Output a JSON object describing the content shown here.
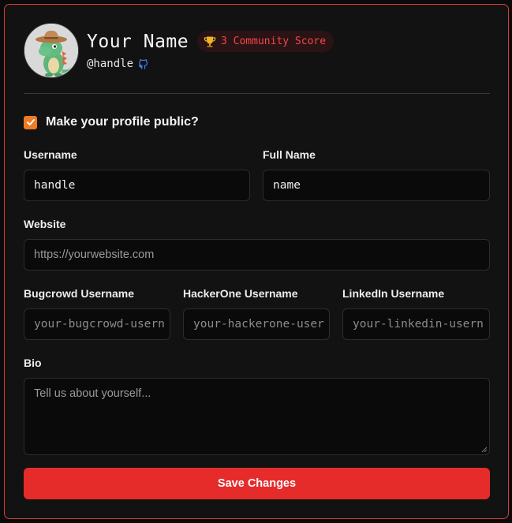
{
  "profile": {
    "display_name": "Your Name",
    "handle": "@handle",
    "score_text": "3 Community Score",
    "avatar_icon": "cowboy-dinosaur-avatar",
    "github_icon": "github-icon"
  },
  "public_toggle": {
    "label": "Make your profile public?",
    "checked": true,
    "color": "#f07b24"
  },
  "fields": {
    "username": {
      "label": "Username",
      "value": "handle"
    },
    "full_name": {
      "label": "Full Name",
      "value": "name"
    },
    "website": {
      "label": "Website",
      "placeholder": "https://yourwebsite.com"
    },
    "bugcrowd": {
      "label": "Bugcrowd Username",
      "placeholder": "your-bugcrowd-usern"
    },
    "hackerone": {
      "label": "HackerOne Username",
      "placeholder": "your-hackerone-user"
    },
    "linkedin": {
      "label": "LinkedIn Username",
      "placeholder": "your-linkedin-usern"
    },
    "bio": {
      "label": "Bio",
      "placeholder": "Tell us about yourself..."
    }
  },
  "save_button": {
    "label": "Save Changes",
    "color": "#e62b2b"
  },
  "colors": {
    "accent_border": "#d43d3d",
    "score_text": "#f04848"
  }
}
